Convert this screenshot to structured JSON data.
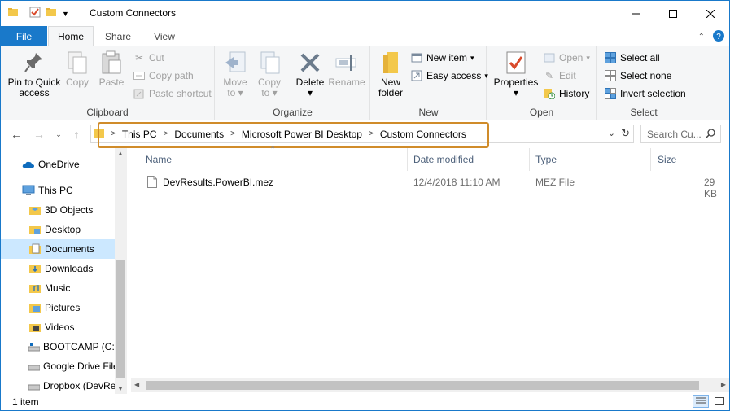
{
  "window": {
    "title": "Custom Connectors"
  },
  "tabs": {
    "file": "File",
    "home": "Home",
    "share": "Share",
    "view": "View"
  },
  "ribbon": {
    "clipboard": {
      "label": "Clipboard",
      "pin": [
        "Pin to Quick",
        "access"
      ],
      "copy": "Copy",
      "paste": "Paste",
      "cut": "Cut",
      "copy_path": "Copy path",
      "paste_shortcut": "Paste shortcut"
    },
    "organize": {
      "label": "Organize",
      "move_to": [
        "Move",
        "to"
      ],
      "copy_to": [
        "Copy",
        "to"
      ],
      "delete": "Delete",
      "rename": "Rename"
    },
    "new": {
      "label": "New",
      "new_folder": [
        "New",
        "folder"
      ],
      "new_item": "New item",
      "easy_access": "Easy access"
    },
    "open": {
      "label": "Open",
      "properties": "Properties",
      "open": "Open",
      "edit": "Edit",
      "history": "History"
    },
    "select": {
      "label": "Select",
      "select_all": "Select all",
      "select_none": "Select none",
      "invert_selection": "Invert selection"
    }
  },
  "address": {
    "crumbs": [
      "This PC",
      "Documents",
      "Microsoft Power BI Desktop",
      "Custom Connectors"
    ],
    "search_placeholder": "Search Cu..."
  },
  "nav": {
    "items": [
      {
        "label": "OneDrive"
      },
      {
        "label": "This PC"
      },
      {
        "label": "3D Objects"
      },
      {
        "label": "Desktop"
      },
      {
        "label": "Documents"
      },
      {
        "label": "Downloads"
      },
      {
        "label": "Music"
      },
      {
        "label": "Pictures"
      },
      {
        "label": "Videos"
      },
      {
        "label": "BOOTCAMP (C:)"
      },
      {
        "label": "Google Drive File"
      },
      {
        "label": "Dropbox (DevRe"
      }
    ]
  },
  "columns": {
    "name": "Name",
    "date": "Date modified",
    "type": "Type",
    "size": "Size"
  },
  "files": [
    {
      "name": "DevResults.PowerBI.mez",
      "date": "12/4/2018 11:10 AM",
      "type": "MEZ File",
      "size": "29 KB"
    }
  ],
  "status": {
    "count": "1 item"
  },
  "colors": {
    "accent": "#1979ca",
    "selection": "#cce8ff",
    "highlight": "#d08c2a"
  }
}
